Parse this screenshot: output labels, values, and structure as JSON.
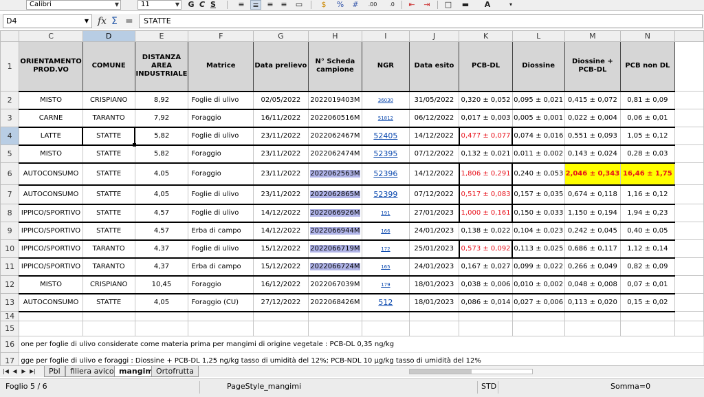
{
  "toolbar": {
    "font_name": "Calibri",
    "font_size": "11",
    "bold_label": "G",
    "italic_label": "C",
    "underline_label": "S",
    "icons": [
      "bold-icon",
      "italic-icon",
      "underline-icon",
      "align-left-icon",
      "align-center-icon",
      "align-right-icon",
      "justify-icon",
      "format-currency-icon",
      "format-percent-icon",
      "format-number-icon",
      "add-decimal-icon",
      "delete-decimal-icon",
      "indent-icon",
      "border-icon",
      "background-color-icon",
      "font-color-icon"
    ]
  },
  "formula_bar": {
    "cell_ref": "D4",
    "function_wizard_icon": "fx",
    "sum_icon": "Σ",
    "equals_icon": "=",
    "content": "STATTE"
  },
  "columns": [
    "C",
    "D",
    "E",
    "F",
    "G",
    "H",
    "I",
    "J",
    "K",
    "L",
    "M",
    "N"
  ],
  "row_numbers": [
    "1",
    "2",
    "3",
    "4",
    "5",
    "6",
    "7",
    "8",
    "9",
    "10",
    "11",
    "12",
    "13",
    "14",
    "15",
    "16",
    "17"
  ],
  "headers": [
    "ORIENTAMENTO PROD.VO",
    "COMUNE",
    "DISTANZA AREA INDUSTRIALE",
    "Matrice",
    "Data prelievo",
    "N° Scheda campione",
    "NGR",
    "Data esito",
    "PCB-DL",
    "Diossine",
    "Diossine + PCB-DL",
    "PCB non DL"
  ],
  "rows": [
    [
      "MISTO",
      "CRISPIANO",
      "8,92",
      "Foglie di ulivo",
      "02/05/2022",
      "2022019403M",
      "36030",
      "31/05/2022",
      "0,320 ± 0,052",
      "0,095 ± 0,021",
      "0,415 ± 0,072",
      "0,81 ± 0,09"
    ],
    [
      "CARNE",
      "TARANTO",
      "7,92",
      "Foraggio",
      "16/11/2022",
      "2022060516M",
      "51812",
      "06/12/2022",
      "0,017 ± 0,003",
      "0,005 ± 0,001",
      "0,022 ± 0,004",
      "0,06 ± 0,01"
    ],
    [
      "LATTE",
      "STATTE",
      "5,82",
      "Foglie di ulivo",
      "23/11/2022",
      "2022062467M",
      "52405",
      "14/12/2022",
      "0,477 ± 0,077",
      "0,074 ± 0,016",
      "0,551 ± 0,093",
      "1,05 ± 0,12"
    ],
    [
      "MISTO",
      "STATTE",
      "5,82",
      "Foraggio",
      "23/11/2022",
      "2022062474M",
      "52395",
      "07/12/2022",
      "0,132 ± 0,021",
      "0,011 ± 0,002",
      "0,143 ± 0,024",
      "0,28 ± 0,03"
    ],
    [
      "AUTOCONSUMO",
      "STATTE",
      "4,05",
      "Foraggio",
      "23/11/2022",
      "2022062563M",
      "52396",
      "14/12/2022",
      "1,806 ± 0,291",
      "0,240 ± 0,053",
      "2,046 ± 0,343",
      "16,46 ± 1,75"
    ],
    [
      "AUTOCONSUMO",
      "STATTE",
      "4,05",
      "Foglie di ulivo",
      "23/11/2022",
      "2022062865M",
      "52399",
      "07/12/2022",
      "0,517 ± 0,083",
      "0,157 ± 0,035",
      "0,674 ± 0,118",
      "1,16 ± 0,12"
    ],
    [
      "IPPICO/SPORTIVO",
      "STATTE",
      "4,57",
      "Foglie di ulivo",
      "14/12/2022",
      "2022066926M",
      "191",
      "27/01/2023",
      "1,000 ± 0,161",
      "0,150 ± 0,033",
      "1,150 ± 0,194",
      "1,94 ± 0,23"
    ],
    [
      "IPPICO/SPORTIVO",
      "STATTE",
      "4,57",
      "Erba di campo",
      "14/12/2022",
      "2022066944M",
      "166",
      "24/01/2023",
      "0,138 ± 0,022",
      "0,104 ± 0,023",
      "0,242 ± 0,045",
      "0,40 ± 0,05"
    ],
    [
      "IPPICO/SPORTIVO",
      "TARANTO",
      "4,37",
      "Foglie di ulivo",
      "15/12/2022",
      "2022066719M",
      "172",
      "25/01/2023",
      "0,573 ± 0,092",
      "0,113 ± 0,025",
      "0,686 ± 0,117",
      "1,12 ± 0,14"
    ],
    [
      "IPPICO/SPORTIVO",
      "TARANTO",
      "4,37",
      "Erba di campo",
      "15/12/2022",
      "2022066724M",
      "165",
      "24/01/2023",
      "0,167 ± 0,027",
      "0,099 ± 0,022",
      "0,266 ± 0,049",
      "0,82 ± 0,09"
    ],
    [
      "MISTO",
      "CRISPIANO",
      "10,45",
      "Foraggio",
      "16/12/2022",
      "2022067039M",
      "179",
      "18/01/2023",
      "0,038 ± 0,006",
      "0,010 ± 0,002",
      "0,048 ± 0,008",
      "0,07 ± 0,01"
    ],
    [
      "AUTOCONSUMO",
      "STATTE",
      "4,05",
      "Foraggio (CU)",
      "27/12/2022",
      "2022068426M",
      "512",
      "18/01/2023",
      "0,086 ± 0,014",
      "0,027 ± 0,006",
      "0,113 ± 0,020",
      "0,15 ± 0,02"
    ]
  ],
  "notes": [
    "one per foglie di ulivo considerate come materia prima per mangimi di origine vegetale : PCB-DL  0,35 ng/kg",
    "gge per foglie di ulivo  e foraggi : Diossine + PCB-DL  1,25 ng/kg tasso di umidità del 12%; PCB-NDL  10 μg/kg tasso di umidità del 12%"
  ],
  "tabs": [
    "Pbl",
    "filiera avicola",
    "mangimi",
    "Ortofrutta"
  ],
  "active_tab": "mangimi",
  "status": {
    "sheet": "Foglio 5 / 6",
    "page_style": "PageStyle_mangimi",
    "mode": "STD",
    "sum": "Somma=0"
  },
  "colors": {
    "accent_selection": "#b8cde4",
    "red_value": "#e8101a",
    "highlight_yellow": "#ffff00",
    "highlight_blue": "#b0b4e8",
    "link": "#0645ad"
  }
}
